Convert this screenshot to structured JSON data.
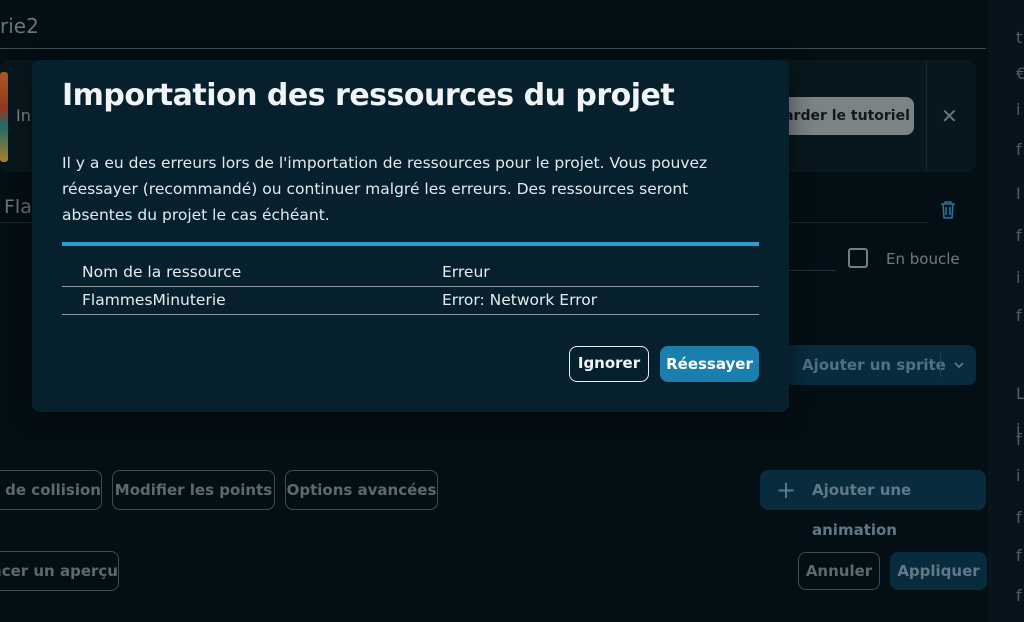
{
  "background": {
    "title": "rie2",
    "card_text_partial": "In",
    "tutorial_button": "arder le tutoriel",
    "field_partial": "Fla",
    "loop_label": "En boucle",
    "add_sprite_button": "Ajouter un sprite",
    "collision_button": "s de collision",
    "edit_points_button": "Modifier les points",
    "advanced_options_button": "Options avancées",
    "add_animation_button": "Ajouter une animation",
    "preview_button": "ncer un aperçu",
    "cancel_button": "Annuler",
    "apply_button": "Appliquer",
    "right_strip_glyphs": [
      "t",
      "€",
      "i",
      "f",
      "I",
      "f",
      "i",
      "f",
      "L",
      "i",
      "f",
      "i",
      "f",
      "f",
      "f"
    ]
  },
  "modal": {
    "title": "Importation des ressources du projet",
    "message": "Il y a eu des erreurs lors de l'importation de ressources pour le projet. Vous pouvez réessayer (recommandé) ou continuer malgré les erreurs. Des ressources seront absentes du projet le cas échéant.",
    "table": {
      "headers": [
        "Nom de la ressource",
        "Erreur"
      ],
      "rows": [
        [
          "FlammesMinuterie",
          "Error: Network Error"
        ]
      ]
    },
    "ignore_button": "Ignorer",
    "retry_button": "Réessayer"
  },
  "colors": {
    "accent": "#1b7fad",
    "table_bar": "#2f9ccf",
    "modal_bg": "#06202d",
    "app_bg": "#06141c"
  }
}
